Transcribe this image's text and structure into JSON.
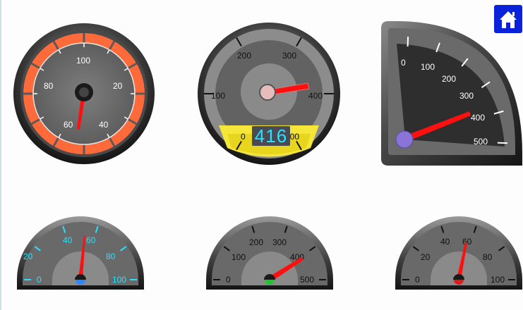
{
  "colors": {
    "home_button": "#0a22d9",
    "needle": "#ff1010",
    "orange_band": "#ff6a3a",
    "cyan_accent": "#23e3ff",
    "yellow_panel": "#f5e63a",
    "purple_hub": "#8a74d8",
    "blue_hub": "#2a86ff",
    "green_hub": "#22c230",
    "red_hub": "#e01818"
  },
  "home": {
    "icon": "home-icon"
  },
  "gauges": [
    {
      "id": "orange-dial",
      "labels": [
        "60",
        "80",
        "100",
        "20",
        "40"
      ],
      "min": 0,
      "max": 100,
      "value": 57,
      "label_color": "#ffffff"
    },
    {
      "id": "digital-dial",
      "labels": [
        "0",
        "100",
        "200",
        "300",
        "400",
        "500"
      ],
      "min": 0,
      "max": 500,
      "value": 416,
      "display_value": "416",
      "label_color": "#111111"
    },
    {
      "id": "quarter-dial",
      "labels": [
        "0",
        "100",
        "200",
        "300",
        "400",
        "500"
      ],
      "min": 0,
      "max": 500,
      "value": 400,
      "label_color": "#ffffff"
    },
    {
      "id": "semi-dial-cyan",
      "labels": [
        "0",
        "20",
        "40",
        "60",
        "80",
        "100"
      ],
      "min": 0,
      "max": 100,
      "value": 56,
      "label_color": "#23e3ff"
    },
    {
      "id": "semi-dial-green",
      "labels": [
        "0",
        "100",
        "200",
        "300",
        "400",
        "500"
      ],
      "min": 0,
      "max": 500,
      "value": 416,
      "label_color": "#111111"
    },
    {
      "id": "semi-dial-red",
      "labels": [
        "0",
        "20",
        "40",
        "60",
        "80",
        "100"
      ],
      "min": 0,
      "max": 100,
      "value": 57,
      "label_color": "#111111"
    }
  ]
}
